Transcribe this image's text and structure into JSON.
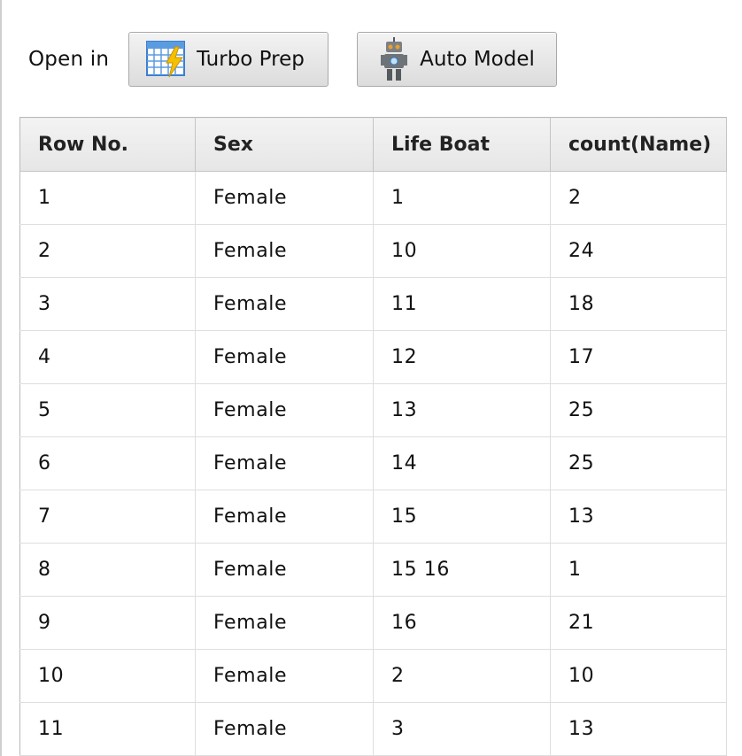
{
  "toolbar": {
    "open_in_label": "Open in",
    "turbo_prep_label": "Turbo Prep",
    "auto_model_label": "Auto Model"
  },
  "table": {
    "headers": [
      "Row No.",
      "Sex",
      "Life Boat",
      "count(Name)"
    ],
    "rows": [
      [
        "1",
        "Female",
        "1",
        "2"
      ],
      [
        "2",
        "Female",
        "10",
        "24"
      ],
      [
        "3",
        "Female",
        "11",
        "18"
      ],
      [
        "4",
        "Female",
        "12",
        "17"
      ],
      [
        "5",
        "Female",
        "13",
        "25"
      ],
      [
        "6",
        "Female",
        "14",
        "25"
      ],
      [
        "7",
        "Female",
        "15",
        "13"
      ],
      [
        "8",
        "Female",
        "15 16",
        "1"
      ],
      [
        "9",
        "Female",
        "16",
        "21"
      ],
      [
        "10",
        "Female",
        "2",
        "10"
      ],
      [
        "11",
        "Female",
        "3",
        "13"
      ]
    ]
  },
  "icons": {
    "turbo_prep": "grid-lightning-icon",
    "auto_model": "robot-icon"
  },
  "colors": {
    "grid_blue": "#4a90d9",
    "bolt_yellow": "#f5c000",
    "robot_gray": "#6d7378"
  }
}
